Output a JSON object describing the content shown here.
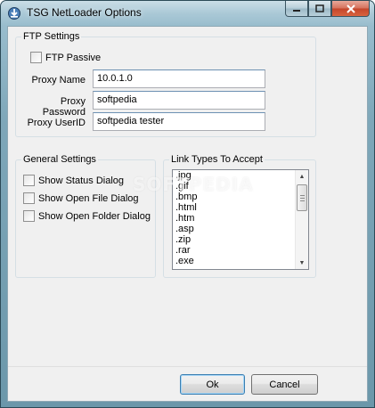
{
  "window": {
    "title": "TSG NetLoader Options",
    "icon": "netloader-app-icon",
    "controls": {
      "minimize": "minimize-icon",
      "maximize": "maximize-icon",
      "close": "close-icon"
    }
  },
  "ftp": {
    "label": "FTP Settings",
    "passive_label": "FTP Passive",
    "passive_checked": false,
    "proxy_name_label": "Proxy Name",
    "proxy_name_value": "10.0.1.0",
    "proxy_password_label": "Proxy Password",
    "proxy_password_value": "softpedia",
    "proxy_userid_label": "Proxy UserID",
    "proxy_userid_value": "softpedia tester"
  },
  "general": {
    "label": "General Settings",
    "options": [
      {
        "label": "Show Status Dialog",
        "checked": false
      },
      {
        "label": "Show Open File Dialog",
        "checked": false
      },
      {
        "label": "Show Open Folder Dialog",
        "checked": false
      }
    ]
  },
  "links": {
    "label": "Link Types To Accept",
    "items": [
      ".jpg",
      ".gif",
      ".bmp",
      ".html",
      ".htm",
      ".asp",
      ".zip",
      ".rar",
      ".exe"
    ]
  },
  "buttons": {
    "ok": "Ok",
    "cancel": "Cancel"
  },
  "watermark": "SOFTPEDIA",
  "colors": {
    "accent": "#3c7fb1",
    "titlebar": "#7ea7b9",
    "client": "#f0f0f0"
  }
}
